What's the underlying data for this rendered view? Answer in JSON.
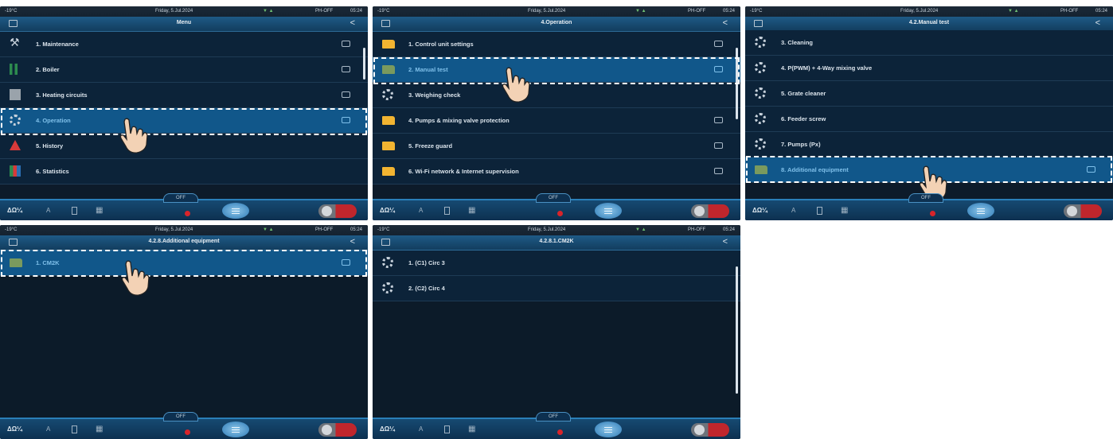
{
  "status": {
    "temp": "-19°C",
    "date": "Friday, 5.Jul.2024",
    "icons": "▼ ▲",
    "info": "PH-OFF",
    "time": "05:24"
  },
  "bottom": {
    "mode": "ΔΩ¼",
    "btn_a": "A",
    "btn_grid": "▦",
    "off": "OFF"
  },
  "screens": [
    {
      "title": "Menu",
      "back": "<",
      "items": [
        {
          "label": "1. Maintenance",
          "icon": "wrench-icon"
        },
        {
          "label": "2. Boiler",
          "icon": "boiler-icon"
        },
        {
          "label": "3. Heating circuits",
          "icon": "heating-circuit-icon"
        },
        {
          "label": "4. Operation",
          "icon": "gear-icon"
        },
        {
          "label": "5. History",
          "icon": "warning-icon"
        },
        {
          "label": "6. Statistics",
          "icon": "statistics-icon"
        }
      ]
    },
    {
      "title": "4.Operation",
      "back": "<",
      "items": [
        {
          "label": "1. Control unit settings",
          "icon": "folder-icon"
        },
        {
          "label": "2. Manual test",
          "icon": "folder-icon"
        },
        {
          "label": "3. Weighing check",
          "icon": "gear-icon"
        },
        {
          "label": "4. Pumps & mixing valve protection",
          "icon": "folder-icon"
        },
        {
          "label": "5. Freeze guard",
          "icon": "folder-icon"
        },
        {
          "label": "6. Wi-Fi network & Internet supervision",
          "icon": "folder-icon"
        }
      ]
    },
    {
      "title": "4.2.Manual test",
      "back": "<",
      "items": [
        {
          "label": "3. Cleaning",
          "icon": "gear-icon"
        },
        {
          "label": "4. P(PWM) + 4-Way mixing valve",
          "icon": "gear-icon"
        },
        {
          "label": "5. Grate cleaner",
          "icon": "gear-icon"
        },
        {
          "label": "6. Feeder screw",
          "icon": "gear-icon"
        },
        {
          "label": "7. Pumps (Px)",
          "icon": "gear-icon"
        },
        {
          "label": "8. Additional equipment",
          "icon": "folder-icon"
        }
      ]
    },
    {
      "title": "4.2.8.Additional equipment",
      "back": "<",
      "items": [
        {
          "label": "1. CM2K",
          "icon": "folder-icon"
        }
      ]
    },
    {
      "title": "4.2.8.1.CM2K",
      "back": "<",
      "items": [
        {
          "label": "1. (C1) Circ 3",
          "icon": "gear-icon"
        },
        {
          "label": "2. (C2) Circ 4",
          "icon": "gear-icon"
        }
      ]
    }
  ]
}
